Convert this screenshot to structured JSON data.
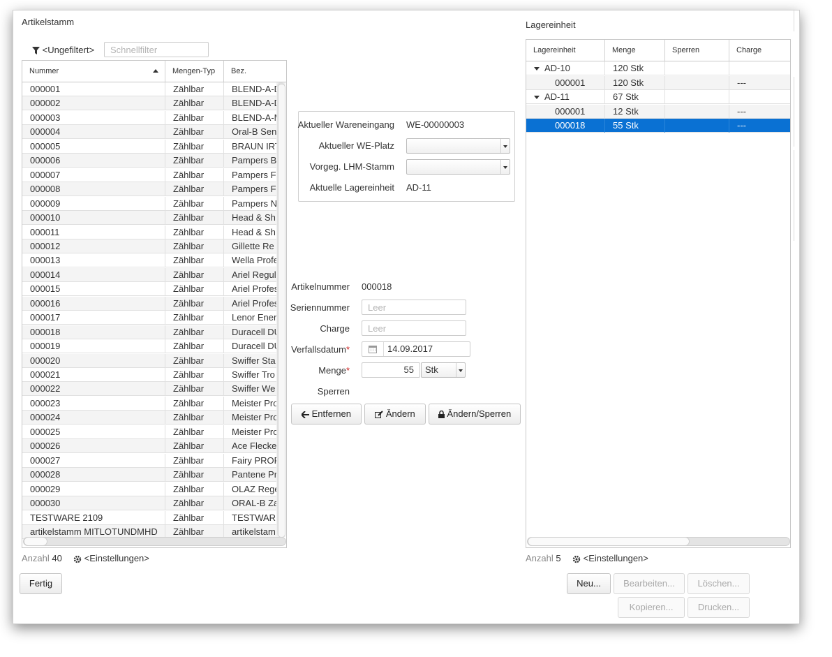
{
  "left": {
    "title": "Artikelstamm",
    "filter_label": "<Ungefiltert>",
    "quickfilter_placeholder": "Schnellfilter",
    "columns": [
      "Nummer",
      "Mengen-Typ",
      "Bez."
    ],
    "rows": [
      [
        "000001",
        "Zählbar",
        "BLEND-A-D"
      ],
      [
        "000002",
        "Zählbar",
        "BLEND-A-D"
      ],
      [
        "000003",
        "Zählbar",
        "BLEND-A-M"
      ],
      [
        "000004",
        "Zählbar",
        "Oral-B Sen"
      ],
      [
        "000005",
        "Zählbar",
        "BRAUN IRT"
      ],
      [
        "000006",
        "Zählbar",
        "Pampers B"
      ],
      [
        "000007",
        "Zählbar",
        "Pampers F"
      ],
      [
        "000008",
        "Zählbar",
        "Pampers F"
      ],
      [
        "000009",
        "Zählbar",
        "Pampers N"
      ],
      [
        "000010",
        "Zählbar",
        "Head & Sh"
      ],
      [
        "000011",
        "Zählbar",
        "Head & Sh"
      ],
      [
        "000012",
        "Zählbar",
        "Gillette Re"
      ],
      [
        "000013",
        "Zählbar",
        "Wella Profe"
      ],
      [
        "000014",
        "Zählbar",
        "Ariel Regul"
      ],
      [
        "000015",
        "Zählbar",
        "Ariel Profes"
      ],
      [
        "000016",
        "Zählbar",
        "Ariel Profes"
      ],
      [
        "000017",
        "Zählbar",
        "Lenor Ener"
      ],
      [
        "000018",
        "Zählbar",
        "Duracell DU"
      ],
      [
        "000019",
        "Zählbar",
        "Duracell DU"
      ],
      [
        "000020",
        "Zählbar",
        "Swiffer Sta"
      ],
      [
        "000021",
        "Zählbar",
        "Swiffer Tro"
      ],
      [
        "000022",
        "Zählbar",
        "Swiffer We"
      ],
      [
        "000023",
        "Zählbar",
        "Meister Pro"
      ],
      [
        "000024",
        "Zählbar",
        "Meister Pro"
      ],
      [
        "000025",
        "Zählbar",
        "Meister Pro"
      ],
      [
        "000026",
        "Zählbar",
        "Ace Flecke"
      ],
      [
        "000027",
        "Zählbar",
        "Fairy PROF"
      ],
      [
        "000028",
        "Zählbar",
        "Pantene Pr"
      ],
      [
        "000029",
        "Zählbar",
        "OLAZ Rege"
      ],
      [
        "000030",
        "Zählbar",
        "ORAL-B Za"
      ],
      [
        "TESTWARE 2109",
        "Zählbar",
        "TESTWAR"
      ],
      [
        "artikelstamm MITLOTUNDMHD",
        "Zählbar",
        "artikelstam"
      ]
    ],
    "count_label": "Anzahl",
    "count_value": "40",
    "settings_label": "<Einstellungen>",
    "done_button": "Fertig"
  },
  "center": {
    "wareneingang_label": "Aktueller Wareneingang",
    "wareneingang_value": "WE-00000003",
    "weplatz_label": "Aktueller WE-Platz",
    "lhm_label": "Vorgeg. LHM-Stamm",
    "lagereinheit_label": "Aktuelle Lagereinheit",
    "lagereinheit_value": "AD-11",
    "artikelnummer_label": "Artikelnummer",
    "artikelnummer_value": "000018",
    "seriennummer_label": "Seriennummer",
    "seriennummer_placeholder": "Leer",
    "charge_label": "Charge",
    "charge_placeholder": "Leer",
    "verfallsdatum_label": "Verfallsdatum",
    "verfallsdatum_value": "14.09.2017",
    "menge_label": "Menge",
    "menge_value": "55",
    "menge_unit": "Stk",
    "sperren_label": "Sperren",
    "required_mark": "*",
    "btn_remove": "Entfernen",
    "btn_change": "Ändern",
    "btn_change_lock": "Ändern/Sperren"
  },
  "right": {
    "title": "Lagereinheit",
    "columns": [
      "Lagereinheit",
      "Menge",
      "Sperren",
      "Charge"
    ],
    "rows": [
      {
        "le": "AD-10",
        "menge": "120 Stk",
        "sperren": "",
        "charge": "",
        "group": true
      },
      {
        "le": "000001",
        "menge": "120 Stk",
        "sperren": "",
        "charge": "---",
        "group": false
      },
      {
        "le": "AD-11",
        "menge": "67 Stk",
        "sperren": "",
        "charge": "",
        "group": true
      },
      {
        "le": "000001",
        "menge": "12 Stk",
        "sperren": "",
        "charge": "---",
        "group": false
      },
      {
        "le": "000018",
        "menge": "55 Stk",
        "sperren": "",
        "charge": "---",
        "group": false,
        "selected": true
      }
    ],
    "count_label": "Anzahl",
    "count_value": "5",
    "settings_label": "<Einstellungen>",
    "btn_new": "Neu...",
    "btn_edit": "Bearbeiten...",
    "btn_delete": "Löschen...",
    "btn_copy": "Kopieren...",
    "btn_print": "Drucken..."
  },
  "colors": {
    "selection": "#0a71d3",
    "required": "#cc2222"
  }
}
